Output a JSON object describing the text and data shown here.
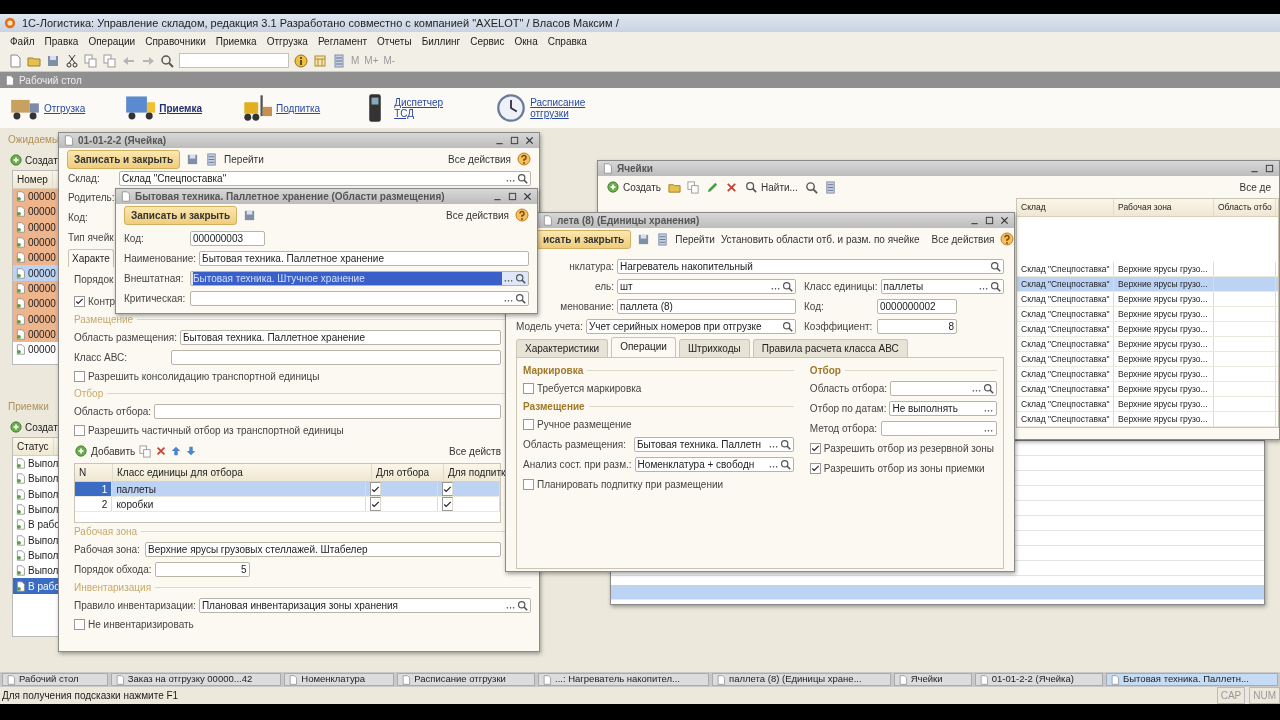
{
  "app": {
    "title": "1С-Логистика: Управление складом, редакция 3.1 Разработано совместно с компанией \"AXELOT\" / Власов Максим /"
  },
  "menu": [
    "Файл",
    "Правка",
    "Операции",
    "Справочники",
    "Приемка",
    "Отгрузка",
    "Регламент",
    "Отчеты",
    "Биллинг",
    "Сервис",
    "Окна",
    "Справка"
  ],
  "toolbar": {
    "memory_buttons": [
      "M",
      "M+",
      "M-"
    ]
  },
  "desktop_tab": "Рабочий стол",
  "shortcuts": [
    {
      "label": "Отгрузка",
      "kind": "truck",
      "selected": false
    },
    {
      "label": "Приемка",
      "kind": "lorry",
      "selected": true
    },
    {
      "label": "Подпитка",
      "kind": "forklift",
      "selected": false
    },
    {
      "label": "Диспетчер ТСД",
      "kind": "scanner",
      "selected": false
    },
    {
      "label": "Расписание отгрузки",
      "kind": "clock",
      "selected": false
    }
  ],
  "expected_list": {
    "title": "Ожидаемы",
    "create": "Создат",
    "column": "Номер",
    "rows": [
      {
        "text": "00000",
        "highlighted": true,
        "selected": false
      },
      {
        "text": "00000",
        "highlighted": true,
        "selected": false
      },
      {
        "text": "00000",
        "highlighted": true,
        "selected": false
      },
      {
        "text": "00000",
        "highlighted": true,
        "selected": false
      },
      {
        "text": "00000",
        "highlighted": true,
        "selected": false
      },
      {
        "text": "00000",
        "highlighted": false,
        "selected": true
      },
      {
        "text": "00000",
        "highlighted": true,
        "selected": false
      },
      {
        "text": "00000",
        "highlighted": true,
        "selected": false
      },
      {
        "text": "00000",
        "highlighted": true,
        "selected": false
      },
      {
        "text": "00000",
        "highlighted": true,
        "selected": false
      },
      {
        "text": "00000",
        "highlighted": false,
        "selected": false
      }
    ]
  },
  "receipts_list": {
    "title": "Приемки",
    "create": "Создат",
    "column": "Статус",
    "rows": [
      {
        "text": "Выпол",
        "selected": false
      },
      {
        "text": "Выпол",
        "selected": false
      },
      {
        "text": "Выпол",
        "selected": false
      },
      {
        "text": "Выпол",
        "selected": false
      },
      {
        "text": "В рабо",
        "selected": false
      },
      {
        "text": "Выпол",
        "selected": false
      },
      {
        "text": "Выпол",
        "selected": false
      },
      {
        "text": "Выпол",
        "selected": false
      },
      {
        "text": "В рабо",
        "selected": true
      }
    ]
  },
  "cell_window": {
    "title": "01-01-2-2 (Ячейка)",
    "save_close": "Записать и закрыть",
    "go": "Перейти",
    "all_actions": "Все действия",
    "warehouse": {
      "label": "Склад:",
      "value": "Склад \"Спецпоставка\""
    },
    "covered_labels": [
      "Родитель:",
      "Код:",
      "Тип ячейк"
    ],
    "tab": "Характе",
    "order_label": "Порядок",
    "control_checkbox": {
      "label": "Контр",
      "checked": true
    },
    "placement_title": "Размещение",
    "placement_area": {
      "label": "Область размещения:",
      "value": "Бытовая техника. Паллетное хранение"
    },
    "abc_class": {
      "label": "Класс АВС:"
    },
    "allow_consolidation": {
      "label": "Разрешить консолидацию транспортной единицы",
      "checked": false
    },
    "picking_title": "Отбор",
    "picking_area": {
      "label": "Область отбора:"
    },
    "allow_partial": {
      "label": "Разрешить частичный отбор из транспортной единицы",
      "checked": false
    },
    "add": "Добавить",
    "table_all_actions": "Все действ",
    "columns": [
      "N",
      "Класс единицы для отбора",
      "Для отбора",
      "Для подпитк"
    ],
    "rows": [
      {
        "n": "1",
        "name": "паллеты",
        "for_picking": true,
        "for_replenish": true,
        "selected": true
      },
      {
        "n": "2",
        "name": "коробки",
        "for_picking": true,
        "for_replenish": true,
        "selected": false
      }
    ],
    "work_zone_title": "Рабочая зона",
    "work_zone": {
      "label": "Рабочая зона:",
      "value": "Верхние ярусы грузовых стеллажей. Штабелер"
    },
    "route_order": {
      "label": "Порядок обхода:",
      "value": "5"
    },
    "inventory_title": "Инвентаризация",
    "inventory_rule": {
      "label": "Правило инвентаризации:",
      "value": "Плановая инвентаризация зоны хранения"
    },
    "no_inventory": {
      "label": "Не инвентаризировать",
      "checked": false
    }
  },
  "area_window": {
    "title": "Бытовая техника. Паллетное хранение (Области размещения)",
    "save_close": "Записать и закрыть",
    "all_actions": "Все действия",
    "fields": [
      {
        "label": "Код:",
        "value": "000000003",
        "kind": "code",
        "selected": false
      },
      {
        "label": "Наименование:",
        "value": "Бытовая техника. Паллетное хранение",
        "kind": "text",
        "selected": false
      },
      {
        "label": "Внештатная:",
        "value": "Бытовая техника. Штучное хранение",
        "kind": "ref",
        "selected": true
      },
      {
        "label": "Критическая:",
        "kind": "ref",
        "selected": false
      }
    ]
  },
  "unit_window": {
    "title": "лета (8) (Единицы хранения)",
    "save_close": "исать и закрыть",
    "go": "Перейти",
    "set_areas": "Установить области отб. и разм. по ячейке",
    "all_actions": "Все действия",
    "nomenclature": {
      "label": "нклатура:",
      "value": "Нагреватель накопительный"
    },
    "unit": {
      "label": "ель:",
      "value": "шт"
    },
    "unit_class": {
      "label": "Класс единицы:",
      "value": "паллеты"
    },
    "name": {
      "label": "менование:",
      "value": "паллета (8)"
    },
    "code": {
      "label": "Код:",
      "value": "0000000002"
    },
    "accounting": {
      "label": "Модель учета:",
      "value": "Учет серийных номеров при отгрузке"
    },
    "factor": {
      "label": "Коэффициент:",
      "value": "8"
    },
    "tabs": [
      {
        "label": "Характеристики",
        "selected": false
      },
      {
        "label": "Операции",
        "selected": true
      },
      {
        "label": "Штрихкоды",
        "selected": false
      },
      {
        "label": "Правила расчета класса АВС",
        "selected": false
      }
    ],
    "marking_title": "Маркировка",
    "marking_required": {
      "label": "Требуется маркировка",
      "checked": false
    },
    "placement_title": "Размещение",
    "manual_placement": {
      "label": "Ручное размещение",
      "checked": false
    },
    "placement_area": {
      "label": "Область размещения:",
      "value": "Бытовая техника. Паллетн"
    },
    "analysis": {
      "label": "Анализ сост. при разм.:",
      "value": "Номенклатура + свободн"
    },
    "plan_replenish": {
      "label": "Планировать подпитку при размещении",
      "checked": false
    },
    "picking_title": "Отбор",
    "picking_area": {
      "label": "Область отбора:"
    },
    "by_dates": {
      "label": "Отбор по датам:",
      "value": "Не выполнять"
    },
    "method": {
      "label": "Метод отбора:"
    },
    "from_reserve": {
      "label": "Разрешить отбор из резервной зоны",
      "checked": true
    },
    "from_receiving": {
      "label": "Разрешить отбор из зоны приемки",
      "checked": true
    }
  },
  "cells_window": {
    "title": "Ячейки",
    "create": "Создать",
    "find": "Найти...",
    "all_actions": "Все де",
    "columns": [
      "Склад",
      "Рабочая зона",
      "Область отбо"
    ],
    "rows": [
      {
        "warehouse": "Склад \"Спецпоставка\"",
        "zone": "Верхние ярусы грузо...",
        "selected": false
      },
      {
        "warehouse": "Склад \"Спецпоставка\"",
        "zone": "Верхние ярусы грузо...",
        "selected": true
      },
      {
        "warehouse": "Склад \"Спецпоставка\"",
        "zone": "Верхние ярусы грузо...",
        "selected": false
      },
      {
        "warehouse": "Склад \"Спецпоставка\"",
        "zone": "Верхние ярусы грузо...",
        "selected": false
      },
      {
        "warehouse": "Склад \"Спецпоставка\"",
        "zone": "Верхние ярусы грузо...",
        "selected": false
      },
      {
        "warehouse": "Склад \"Спецпоставка\"",
        "zone": "Верхние ярусы грузо...",
        "selected": false
      },
      {
        "warehouse": "Склад \"Спецпоставка\"",
        "zone": "Верхние ярусы грузо...",
        "selected": false
      },
      {
        "warehouse": "Склад \"Спецпоставка\"",
        "zone": "Верхние ярусы грузо...",
        "selected": false
      },
      {
        "warehouse": "Склад \"Спецпоставка\"",
        "zone": "Верхние ярусы грузо...",
        "selected": false
      },
      {
        "warehouse": "Склад \"Спецпоставка\"",
        "zone": "Верхние ярусы грузо...",
        "selected": false
      },
      {
        "warehouse": "Склад \"Спецпоставка\"",
        "zone": "Верхние ярусы грузо...",
        "selected": false
      }
    ]
  },
  "taskbar": [
    {
      "label": "Рабочий стол",
      "selected": false
    },
    {
      "label": "Заказ на отгрузку 00000...42",
      "selected": false
    },
    {
      "label": "Номенклатура",
      "selected": false
    },
    {
      "label": "Расписание отгрузки",
      "selected": false
    },
    {
      "label": "...: Нагреватель накопител...",
      "selected": false
    },
    {
      "label": "паллета (8) (Единицы хране...",
      "selected": false
    },
    {
      "label": "Ячейки",
      "selected": false
    },
    {
      "label": "01-01-2-2 (Ячейка)",
      "selected": false
    },
    {
      "label": "Бытовая техника. Паллетн...",
      "selected": true
    }
  ],
  "status_bar": {
    "hint": "Для получения подсказки нажмите F1",
    "indicators": [
      "CAP",
      "NUM"
    ]
  }
}
